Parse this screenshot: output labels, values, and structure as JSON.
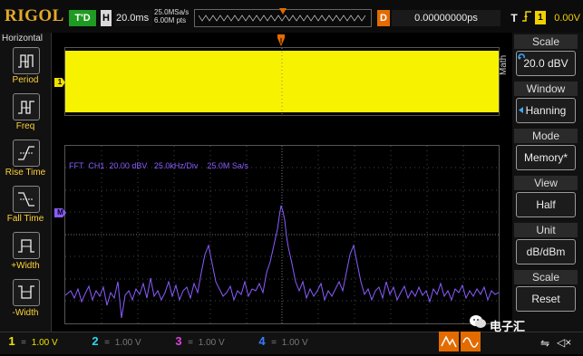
{
  "topbar": {
    "logo": "RIGOL",
    "run_status": "T'D",
    "horizontal_label": "H",
    "timebase": "20.0ms",
    "sample_rate": "25.0MSa/s",
    "memory_depth": "6.00M pts",
    "delay_label": "D",
    "delay_value": "0.00000000ps",
    "trigger_label": "T",
    "trigger_edge": "rising",
    "trigger_source": "1",
    "trigger_level": "0.00V"
  },
  "left_menu": {
    "header": "Horizontal",
    "items": [
      {
        "label": "Period"
      },
      {
        "label": "Freq"
      },
      {
        "label": "Rise Time"
      },
      {
        "label": "Fall Time"
      },
      {
        "label": "+Width"
      },
      {
        "label": "-Width"
      }
    ]
  },
  "screen": {
    "math_tab": "Math",
    "fft_info": "FFT  CH1  20.00 dBV   25.0kHz/Div    25.0M Sa/s",
    "channel_marker": "1",
    "fft_marker": "M"
  },
  "right_menu": {
    "items": [
      {
        "title": "Scale",
        "value": "20.0 dBV"
      },
      {
        "title": "Window",
        "value": "Hanning"
      },
      {
        "title": "Mode",
        "value": "Memory*"
      },
      {
        "title": "View",
        "value": "Half"
      },
      {
        "title": "Unit",
        "value": "dB/dBm"
      },
      {
        "title": "Scale",
        "value": "Reset"
      }
    ]
  },
  "bottombar": {
    "channels": [
      {
        "num": "1",
        "coupling": "=",
        "scale": "1.00 V",
        "color": "#f0e000"
      },
      {
        "num": "2",
        "coupling": "=",
        "scale": "1.00 V",
        "color": "#27d9f2"
      },
      {
        "num": "3",
        "coupling": "=",
        "scale": "1.00 V",
        "color": "#e040e0"
      },
      {
        "num": "4",
        "coupling": "=",
        "scale": "1.00 V",
        "color": "#3a7bff"
      }
    ]
  },
  "watermark": "电子汇",
  "colors": {
    "ch1": "#f0e000",
    "fft": "#7a5cff",
    "accent": "#e36b00",
    "grid": "#555555"
  }
}
